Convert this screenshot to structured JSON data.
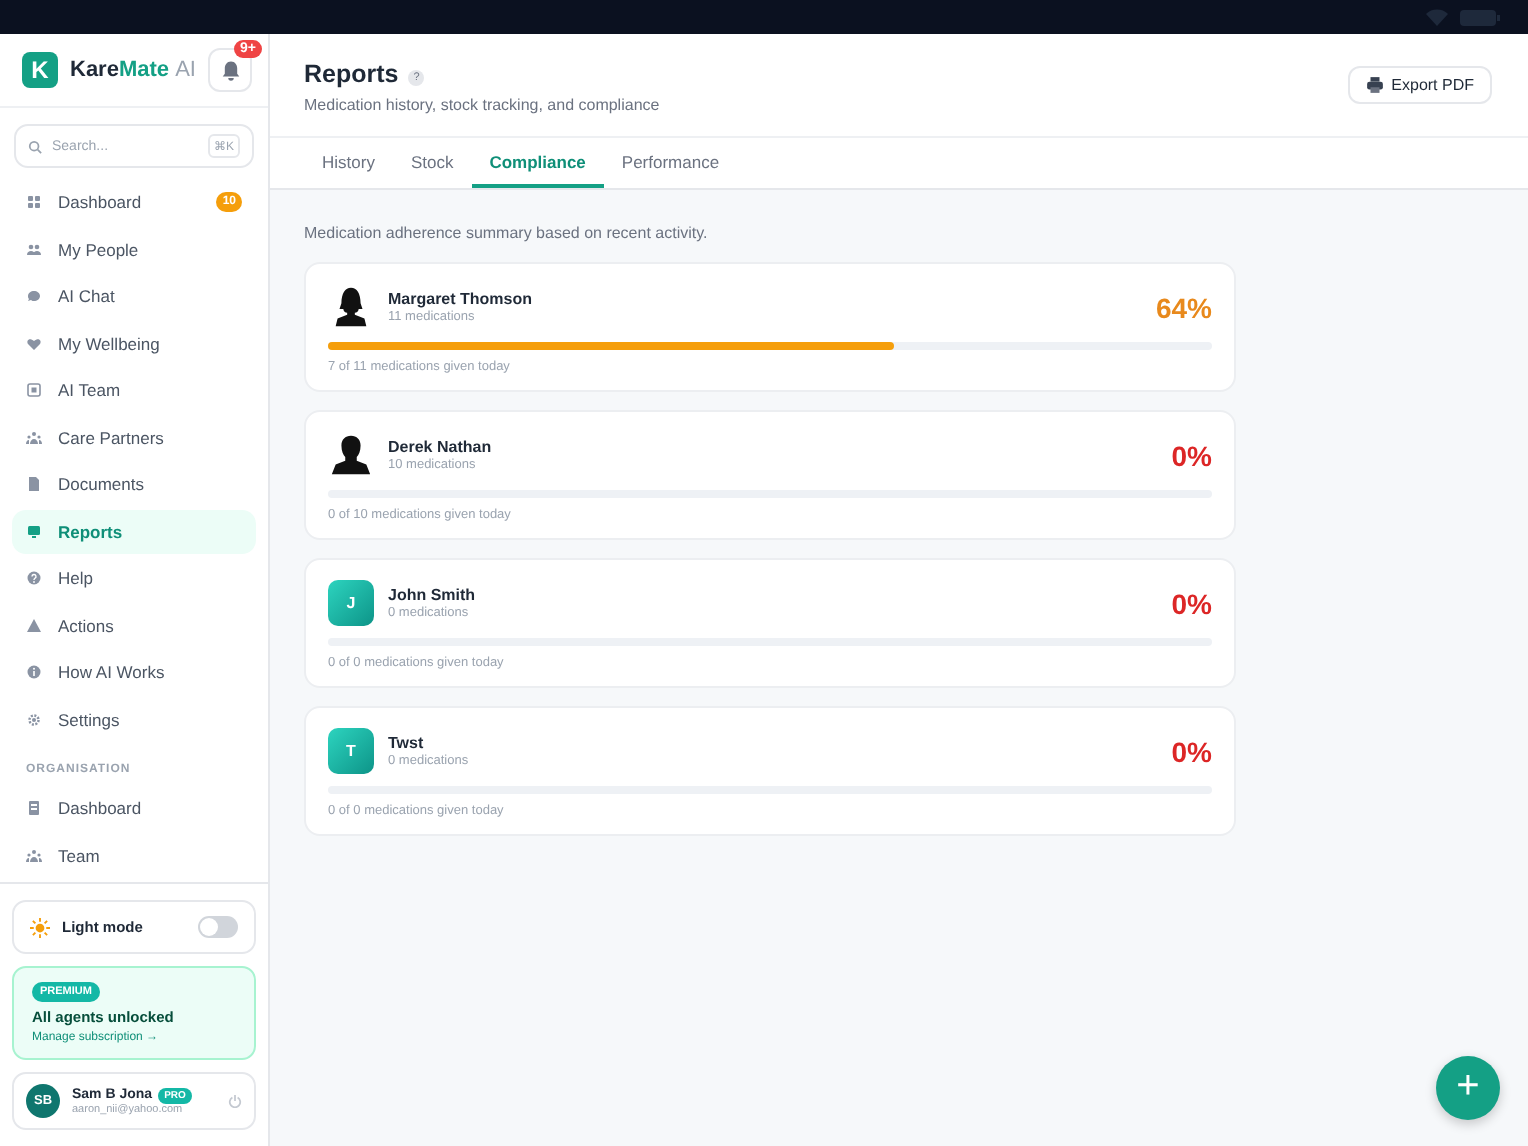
{
  "brand": {
    "name_part1": "Kare",
    "name_part2": "Mate",
    "name_part3": "AI",
    "logo_letter": "K",
    "notification_badge": "9+"
  },
  "search": {
    "placeholder": "Search...",
    "shortcut": "⌘K"
  },
  "nav": [
    {
      "label": "Dashboard",
      "selected": false,
      "badge": "10"
    },
    {
      "label": "My People",
      "selected": false
    },
    {
      "label": "AI Chat",
      "selected": false
    },
    {
      "label": "My Wellbeing",
      "selected": false
    },
    {
      "label": "AI Team",
      "selected": false
    },
    {
      "label": "Care Partners",
      "selected": false
    },
    {
      "label": "Documents",
      "selected": false
    },
    {
      "label": "Reports",
      "selected": true
    },
    {
      "label": "Help",
      "selected": false
    },
    {
      "label": "Actions",
      "selected": false
    },
    {
      "label": "How AI Works",
      "selected": false
    },
    {
      "label": "Settings",
      "selected": false
    }
  ],
  "org_section": {
    "heading": "ORGANISATION",
    "items": [
      {
        "label": "Dashboard",
        "selected": false
      },
      {
        "label": "Team",
        "selected": false
      }
    ]
  },
  "theme_toggle": {
    "label": "Light mode",
    "on": false
  },
  "premium": {
    "badge": "PREMIUM",
    "title": "All agents unlocked",
    "link": "Manage subscription →"
  },
  "user": {
    "initials": "SB",
    "name": "Sam B Jona",
    "plan": "PRO",
    "email": "aaron_nii@yahoo.com"
  },
  "header": {
    "title": "Reports",
    "help_mark": "?",
    "subtitle": "Medication history, stock tracking, and compliance",
    "export_button": "Export PDF"
  },
  "tabs": [
    {
      "label": "History",
      "selected": false
    },
    {
      "label": "Stock",
      "selected": false
    },
    {
      "label": "Compliance",
      "selected": true
    },
    {
      "label": "Performance",
      "selected": false
    }
  ],
  "summary": "Medication adherence summary based on recent activity.",
  "people": [
    {
      "name": "Margaret Thomson",
      "avatar": {
        "kind": "silhouette-female"
      },
      "medications": "11 medications",
      "percent": "64%",
      "color": "#e8891c",
      "level": 0.64,
      "given": "7 of 11 medications given today"
    },
    {
      "name": "Derek Nathan",
      "avatar": {
        "kind": "silhouette-male"
      },
      "medications": "10 medications",
      "percent": "0%",
      "color": "#dc2626",
      "given": "0 of 10 medications given today"
    },
    {
      "name": "John Smith",
      "avatar": {
        "kind": "letter",
        "letter": "J"
      },
      "medications": "0 medications",
      "percent": "0%",
      "color": "#dc2626",
      "given": "0 of 0 medications given today"
    },
    {
      "name": "Twst",
      "avatar": {
        "kind": "letter",
        "letter": "T"
      },
      "medications": "0 medications",
      "percent": "0%",
      "color": "#dc2626",
      "given": "0 of 0 medications given today"
    }
  ],
  "fab": {
    "symbol": "+"
  }
}
